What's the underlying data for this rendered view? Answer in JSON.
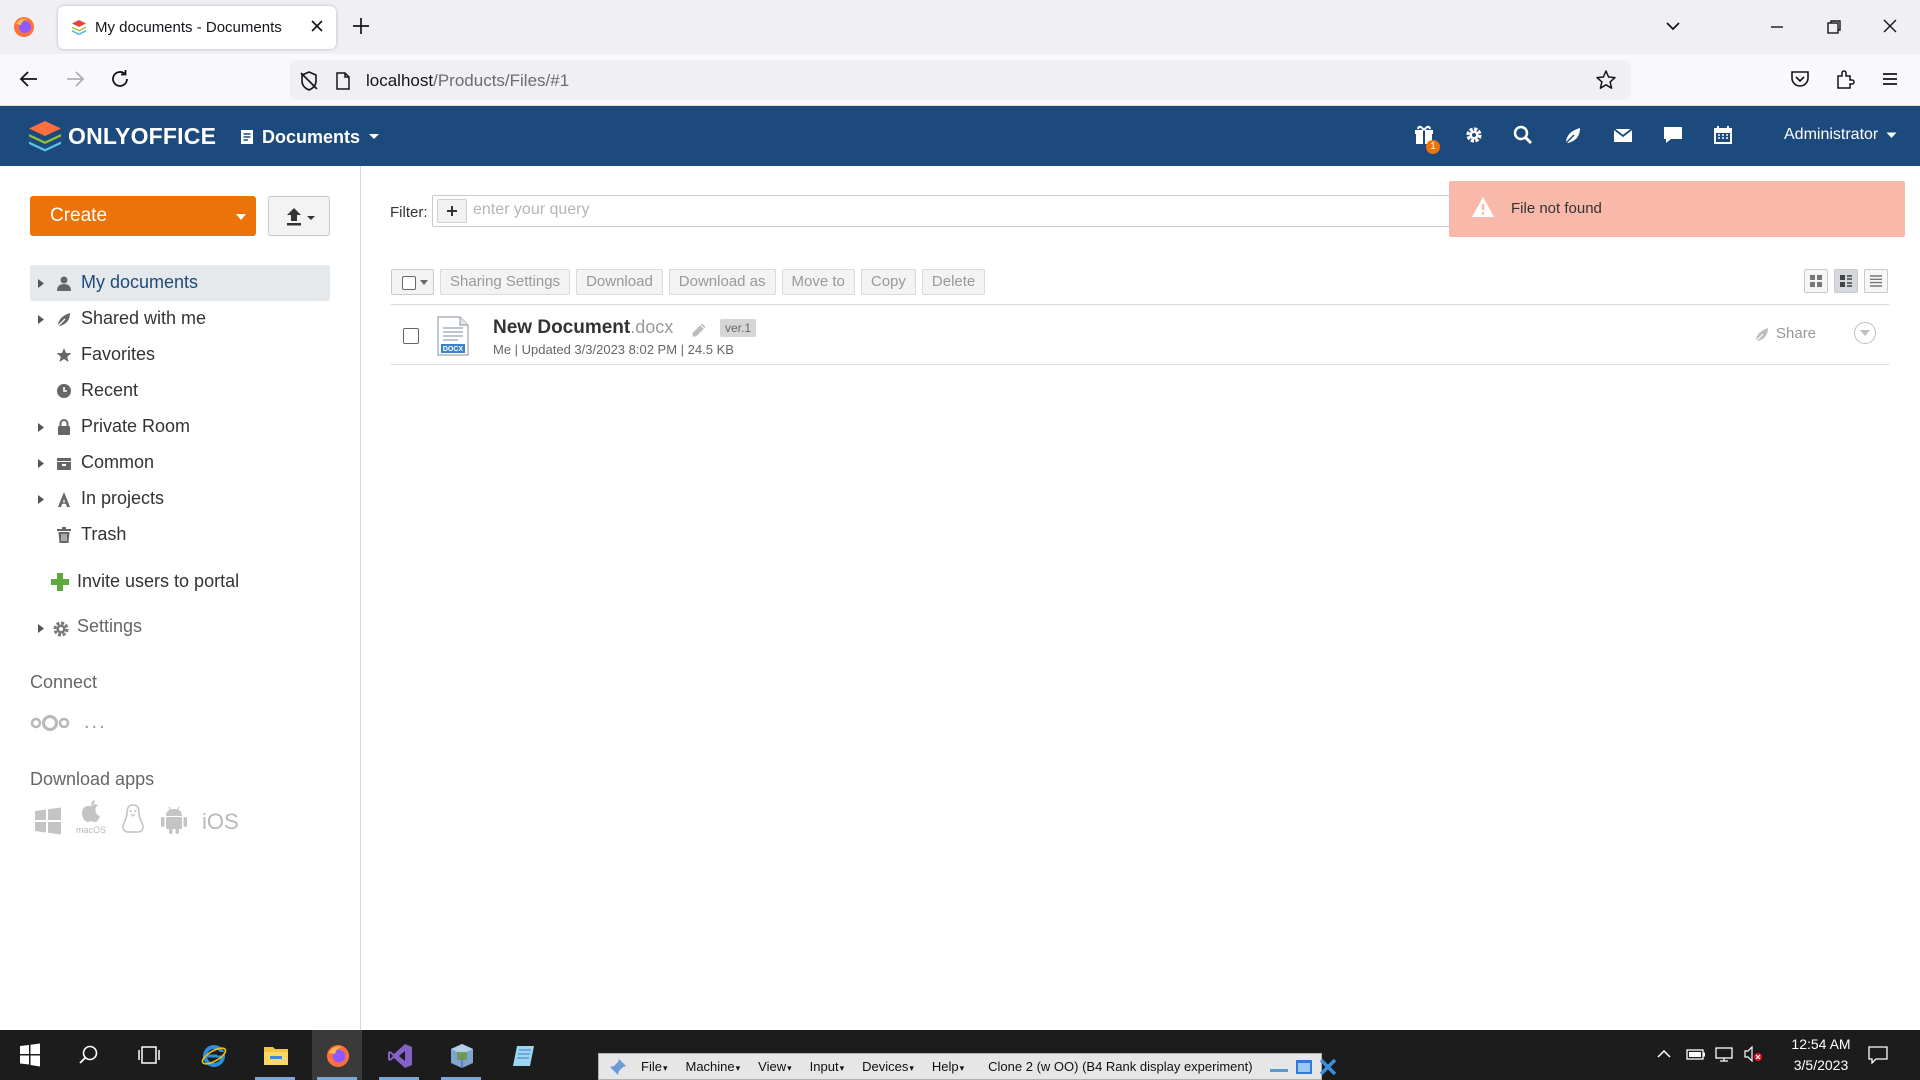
{
  "browser": {
    "tab_title": "My documents - Documents",
    "url_host": "localhost",
    "url_path": "/Products/Files/#1"
  },
  "header": {
    "brand": "ONLYOFFICE",
    "module": "Documents",
    "gift_badge_count": "1",
    "user": "Administrator",
    "icons": [
      "gift-icon",
      "settings-icon",
      "search-icon",
      "feed-icon",
      "mail-icon",
      "chat-icon",
      "calendar-icon"
    ]
  },
  "sidebar": {
    "create_label": "Create",
    "items": [
      {
        "label": "My documents",
        "icon": "person-icon",
        "expandable": true,
        "active": true
      },
      {
        "label": "Shared with me",
        "icon": "shared-icon",
        "expandable": true
      },
      {
        "label": "Favorites",
        "icon": "star-icon",
        "expandable": false
      },
      {
        "label": "Recent",
        "icon": "clock-icon",
        "expandable": false
      },
      {
        "label": "Private Room",
        "icon": "lock-icon",
        "expandable": true
      },
      {
        "label": "Common",
        "icon": "common-folder-icon",
        "expandable": true
      },
      {
        "label": "In projects",
        "icon": "projects-icon",
        "expandable": true
      },
      {
        "label": "Trash",
        "icon": "trash-icon",
        "expandable": false
      }
    ],
    "invite_label": "Invite users to portal",
    "settings_label": "Settings",
    "connect_label": "Connect",
    "connect_more": "...",
    "download_apps_label": "Download apps",
    "apps": [
      "windows-icon",
      "macos-icon",
      "linux-icon",
      "android-icon"
    ],
    "macos_caption": "macOS",
    "ios_label": "iOS"
  },
  "main": {
    "filter_label": "Filter:",
    "filter_placeholder": "enter your query",
    "toolbar": {
      "sharing_settings": "Sharing Settings",
      "download": "Download",
      "download_as": "Download as",
      "move_to": "Move to",
      "copy": "Copy",
      "delete": "Delete"
    },
    "files": [
      {
        "name": "New Document",
        "ext": ".docx",
        "version": "ver.1",
        "meta": "Me | Updated 3/3/2023 8:02 PM | 24.5 KB",
        "share_label": "Share",
        "icon_caption": "DOCX"
      }
    ]
  },
  "toast": {
    "message": "File not found"
  },
  "taskbar": {
    "vbox_menus": [
      "File",
      "Machine",
      "View",
      "Input",
      "Devices",
      "Help"
    ],
    "vbox_title": "Clone 2 (w OO) (B4 Rank display experiment)",
    "time": "12:54 AM",
    "date": "3/5/2023"
  },
  "colors": {
    "portal_header": "#1d4a7c",
    "create_button": "#ed7309",
    "toast_background": "#f8b9aa"
  }
}
